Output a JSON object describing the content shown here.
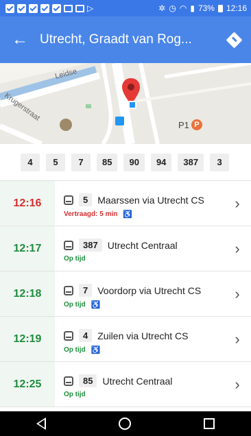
{
  "status_bar": {
    "battery": "73%",
    "time": "12:16"
  },
  "app_bar": {
    "title": "Utrecht, Graadt van Rog..."
  },
  "map": {
    "labels": [
      "Leidse",
      "Krugerstraat",
      "P1"
    ]
  },
  "routes": [
    "4",
    "5",
    "7",
    "85",
    "90",
    "94",
    "387",
    "3"
  ],
  "departures": [
    {
      "time": "12:16",
      "route": "5",
      "destination": "Maarssen via Utrecht CS",
      "status": "Vertraagd: 5 min",
      "accessible": true,
      "status_color": "#d32f2f"
    },
    {
      "time": "12:17",
      "route": "387",
      "destination": "Utrecht Centraal",
      "status": "Op tijd",
      "accessible": false,
      "status_color": "#1e8e3e"
    },
    {
      "time": "12:18",
      "route": "7",
      "destination": "Voordorp via Utrecht CS",
      "status": "Op tijd",
      "accessible": true,
      "status_color": "#1e8e3e"
    },
    {
      "time": "12:19",
      "route": "4",
      "destination": "Zuilen via Utrecht CS",
      "status": "Op tijd",
      "accessible": true,
      "status_color": "#1e8e3e"
    },
    {
      "time": "12:25",
      "route": "85",
      "destination": "Utrecht Centraal",
      "status": "Op tijd",
      "accessible": false,
      "status_color": "#1e8e3e"
    }
  ],
  "colors": {
    "primary": "#4a86e8",
    "status_bar": "#3b78e7",
    "delayed": "#d32f2f",
    "on_time": "#1e8e3e",
    "pin": "#e53935",
    "transit_stop": "#2196f3"
  }
}
